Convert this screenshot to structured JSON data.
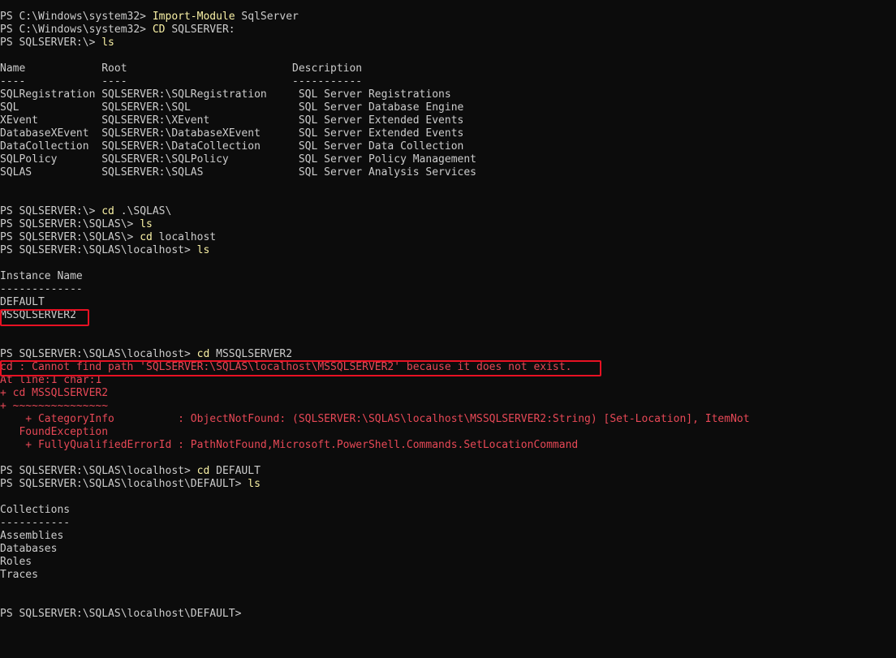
{
  "terminal": {
    "lines": [
      {
        "text": "PS C:\\Windows\\system32> Import-Module SqlServer",
        "kind": "prompt"
      },
      {
        "text": "PS C:\\Windows\\system32> CD SQLSERVER:",
        "kind": "prompt"
      },
      {
        "text": "PS SQLSERVER:\\> ls",
        "kind": "prompt"
      },
      {
        "text": "",
        "kind": "blank"
      },
      {
        "text": "Name            Root                          Description",
        "kind": "output"
      },
      {
        "text": "----            ----                          -----------",
        "kind": "output"
      },
      {
        "text": "SQLRegistration SQLSERVER:\\SQLRegistration     SQL Server Registrations",
        "kind": "output"
      },
      {
        "text": "SQL             SQLSERVER:\\SQL                 SQL Server Database Engine",
        "kind": "output"
      },
      {
        "text": "XEvent          SQLSERVER:\\XEvent              SQL Server Extended Events",
        "kind": "output"
      },
      {
        "text": "DatabaseXEvent  SQLSERVER:\\DatabaseXEvent      SQL Server Extended Events",
        "kind": "output"
      },
      {
        "text": "DataCollection  SQLSERVER:\\DataCollection      SQL Server Data Collection",
        "kind": "output"
      },
      {
        "text": "SQLPolicy       SQLSERVER:\\SQLPolicy           SQL Server Policy Management",
        "kind": "output"
      },
      {
        "text": "SQLAS           SQLSERVER:\\SQLAS               SQL Server Analysis Services",
        "kind": "output"
      },
      {
        "text": "",
        "kind": "blank"
      },
      {
        "text": "",
        "kind": "blank"
      },
      {
        "text": "PS SQLSERVER:\\> cd .\\SQLAS\\",
        "kind": "prompt"
      },
      {
        "text": "PS SQLSERVER:\\SQLAS\\> ls",
        "kind": "prompt"
      },
      {
        "text": "PS SQLSERVER:\\SQLAS\\> cd localhost",
        "kind": "prompt"
      },
      {
        "text": "PS SQLSERVER:\\SQLAS\\localhost> ls",
        "kind": "prompt"
      },
      {
        "text": "",
        "kind": "blank"
      },
      {
        "text": "Instance Name",
        "kind": "output"
      },
      {
        "text": "-------------",
        "kind": "output"
      },
      {
        "text": "DEFAULT",
        "kind": "output"
      },
      {
        "text": "MSSQLSERVER2",
        "kind": "output"
      },
      {
        "text": "",
        "kind": "blank"
      },
      {
        "text": "",
        "kind": "blank"
      },
      {
        "text": "PS SQLSERVER:\\SQLAS\\localhost> cd MSSQLSERVER2",
        "kind": "prompt"
      },
      {
        "text": "cd : Cannot find path 'SQLSERVER:\\SQLAS\\localhost\\MSSQLSERVER2' because it does not exist.",
        "kind": "error"
      },
      {
        "text": "At line:1 char:1",
        "kind": "error"
      },
      {
        "text": "+ cd MSSQLSERVER2",
        "kind": "error"
      },
      {
        "text": "+ ~~~~~~~~~~~~~~~",
        "kind": "error"
      },
      {
        "text": "    + CategoryInfo          : ObjectNotFound: (SQLSERVER:\\SQLAS\\localhost\\MSSQLSERVER2:String) [Set-Location], ItemNot",
        "kind": "error"
      },
      {
        "text": "   FoundException",
        "kind": "error"
      },
      {
        "text": "    + FullyQualifiedErrorId : PathNotFound,Microsoft.PowerShell.Commands.SetLocationCommand",
        "kind": "error"
      },
      {
        "text": "",
        "kind": "blank"
      },
      {
        "text": "PS SQLSERVER:\\SQLAS\\localhost> cd DEFAULT",
        "kind": "prompt"
      },
      {
        "text": "PS SQLSERVER:\\SQLAS\\localhost\\DEFAULT> ls",
        "kind": "prompt"
      },
      {
        "text": "",
        "kind": "blank"
      },
      {
        "text": "Collections",
        "kind": "output"
      },
      {
        "text": "-----------",
        "kind": "output"
      },
      {
        "text": "Assemblies",
        "kind": "output"
      },
      {
        "text": "Databases",
        "kind": "output"
      },
      {
        "text": "Roles",
        "kind": "output"
      },
      {
        "text": "Traces",
        "kind": "output"
      },
      {
        "text": "",
        "kind": "blank"
      },
      {
        "text": "",
        "kind": "blank"
      },
      {
        "text": "PS SQLSERVER:\\SQLAS\\localhost\\DEFAULT>",
        "kind": "prompt"
      }
    ]
  },
  "colors": {
    "background": "#0c0c0c",
    "foreground": "#cccccc",
    "command": "#f9f1a5",
    "error": "#e74856",
    "annotation_box": "#e81123"
  }
}
